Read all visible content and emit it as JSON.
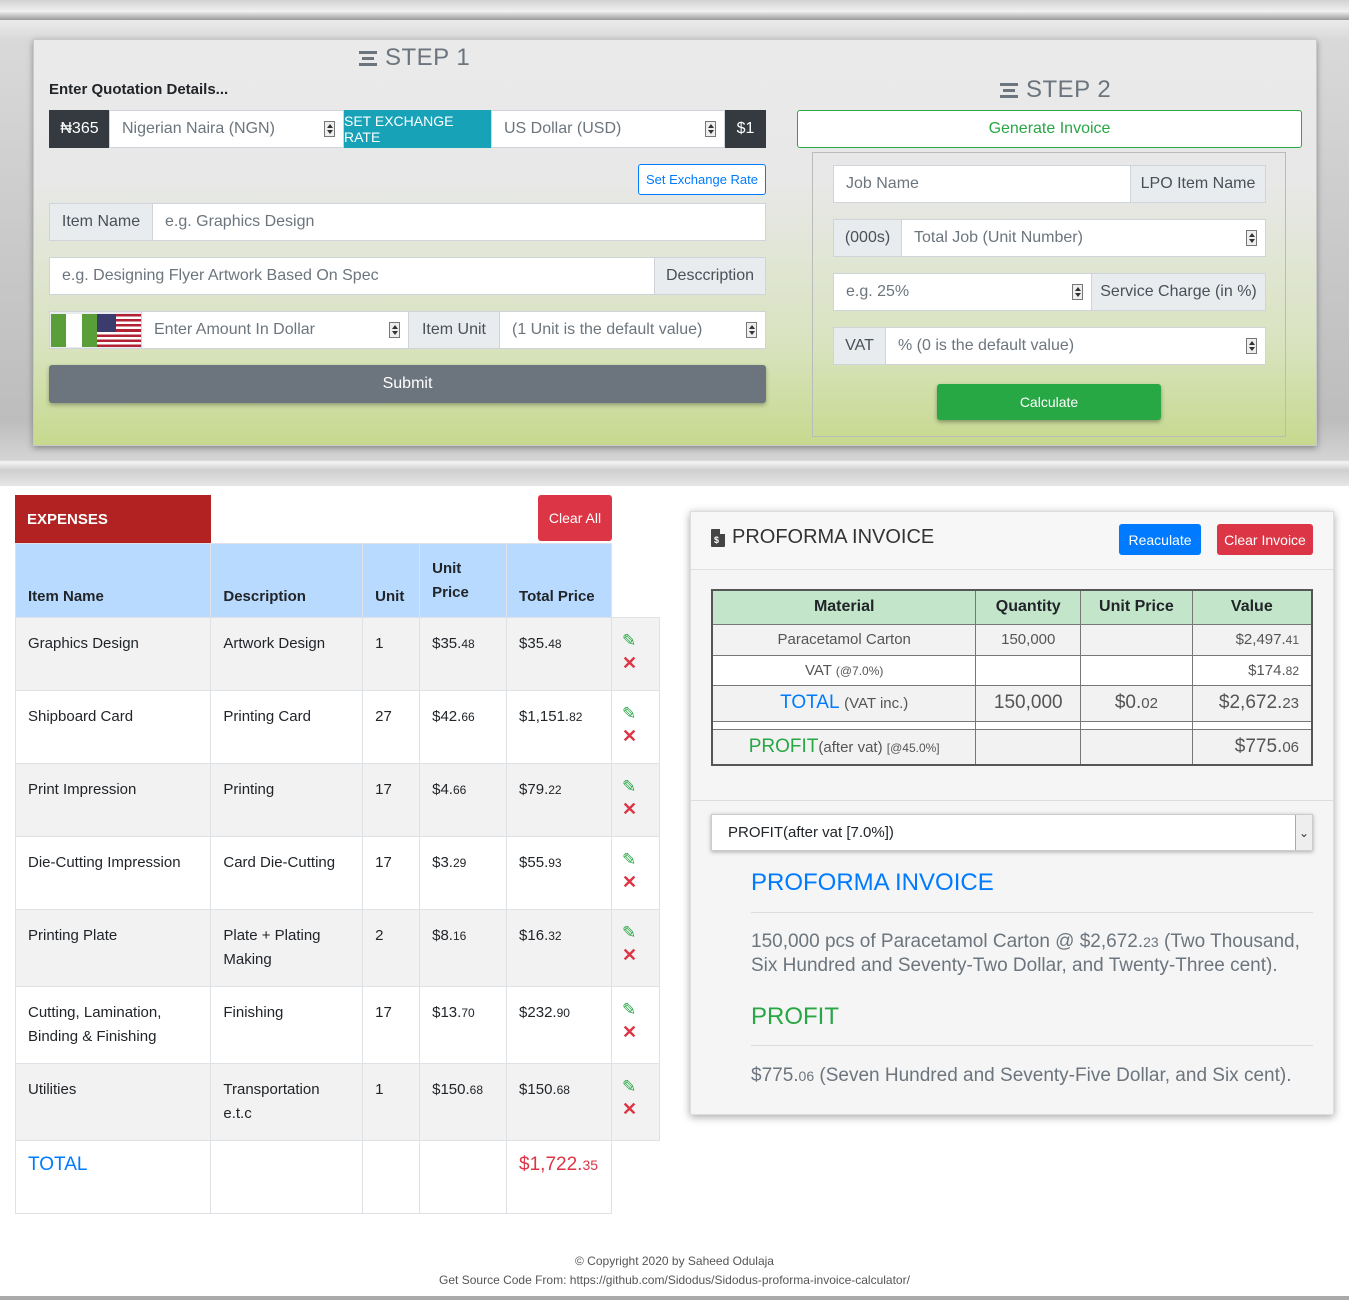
{
  "step1": {
    "title": "STEP 1",
    "heading": "Enter Quotation Details...",
    "rate_prefix": "₦365",
    "from_currency": "Nigerian Naira (NGN)",
    "set_rate_label": "SET EXCHANGE RATE",
    "to_currency": "US Dollar (USD)",
    "usd_suffix": "$1",
    "set_rate_button": "Set Exchange Rate",
    "item_name_label": "Item Name",
    "item_name_placeholder": "e.g. Graphics Design",
    "description_placeholder": "e.g. Designing Flyer Artwork Based On Spec",
    "description_label": "Desccription",
    "amount_placeholder": "Enter Amount In Dollar",
    "item_unit_label": "Item Unit",
    "unit_placeholder": "(1 Unit is the default value)",
    "submit_label": "Submit"
  },
  "step2": {
    "title": "STEP 2",
    "generate_label": "Generate Invoice",
    "job_name_placeholder": "Job Name",
    "lpo_label": "LPO Item Name",
    "units_label": "(000s)",
    "total_job_placeholder": "Total Job (Unit Number)",
    "service_placeholder": "e.g. 25%",
    "service_label": "Service Charge (in %)",
    "vat_label": "VAT",
    "vat_placeholder": "% (0 is the default value)",
    "calculate_label": "Calculate"
  },
  "expenses": {
    "title": "EXPENSES",
    "clear_all": "Clear All",
    "columns": [
      "Item Name",
      "Description",
      "Unit",
      "Unit Price",
      "Total Price"
    ],
    "rows": [
      {
        "name": "Graphics Design",
        "description": "Artwork Design",
        "unit": "1",
        "unit_price": "$35.",
        "unit_price_c": "48",
        "total": "$35.",
        "total_c": "48"
      },
      {
        "name": "Shipboard Card",
        "description": "Printing Card",
        "unit": "27",
        "unit_price": "$42.",
        "unit_price_c": "66",
        "total": "$1,151.",
        "total_c": "82"
      },
      {
        "name": "Print Impression",
        "description": "Printing",
        "unit": "17",
        "unit_price": "$4.",
        "unit_price_c": "66",
        "total": "$79.",
        "total_c": "22"
      },
      {
        "name": "Die-Cutting Impression",
        "description": "Card Die-Cutting",
        "unit": "17",
        "unit_price": "$3.",
        "unit_price_c": "29",
        "total": "$55.",
        "total_c": "93"
      },
      {
        "name": "Printing Plate",
        "description": "Plate + Plating Making",
        "unit": "2",
        "unit_price": "$8.",
        "unit_price_c": "16",
        "total": "$16.",
        "total_c": "32"
      },
      {
        "name": "Cutting, Lamination, Binding & Finishing",
        "description": "Finishing",
        "unit": "17",
        "unit_price": "$13.",
        "unit_price_c": "70",
        "total": "$232.",
        "total_c": "90"
      },
      {
        "name": "Utilities",
        "description": "Transportation e.t.c",
        "unit": "1",
        "unit_price": "$150.",
        "unit_price_c": "68",
        "total": "$150.",
        "total_c": "68"
      }
    ],
    "total_label": "TOTAL",
    "total_value": "$1,722.",
    "total_value_c": "35"
  },
  "invoice": {
    "title": "PROFORMA INVOICE",
    "recalculate": "Reaculate",
    "clear_invoice": "Clear Invoice",
    "columns": [
      "Material",
      "Quantity",
      "Unit Price",
      "Value"
    ],
    "material": "Paracetamol Carton",
    "quantity": "150,000",
    "value": "$2,497.",
    "value_c": "41",
    "vat_label": "VAT",
    "vat_rate": "(@7.0%)",
    "vat_value": "$174.",
    "vat_value_c": "82",
    "total_label": "TOTAL",
    "total_note": "(VAT inc.)",
    "total_qty": "150,000",
    "total_unit": "$0.",
    "total_unit_c": "02",
    "total_value": "$2,672.",
    "total_value_c": "23",
    "profit_label": "PROFIT",
    "profit_note": "(after vat)",
    "profit_rate": "[@45.0%]",
    "profit_value": "$775.",
    "profit_value_c": "06",
    "select_value": "PROFIT(after vat [7.0%])",
    "summary_title": "PROFORMA INVOICE",
    "summary_text_a": "150,000 pcs of Paracetamol Carton @ $2,672.",
    "summary_text_c": "23",
    "summary_text_b": " (Two Thousand, Six Hundred and Seventy-Two Dollar, and Twenty-Three cent).",
    "profit_title": "PROFIT",
    "profit_text_a": "$775.",
    "profit_text_c": "06",
    "profit_text_b": " (Seven Hundred and Seventy-Five Dollar, and Six cent)."
  },
  "footer": {
    "copyright": "© Copyright 2020 by Saheed Odulaja",
    "source": "Get Source Code From: https://github.com/Sidodus/Sidodus-proforma-invoice-calculator/"
  },
  "colors": {
    "primary": "#007bff",
    "success": "#28a745",
    "danger": "#dc3545",
    "info": "#17a2b8",
    "expenses_header": "#b22222",
    "table_header": "#b8daff",
    "invoice_header": "#c3e6cb"
  }
}
